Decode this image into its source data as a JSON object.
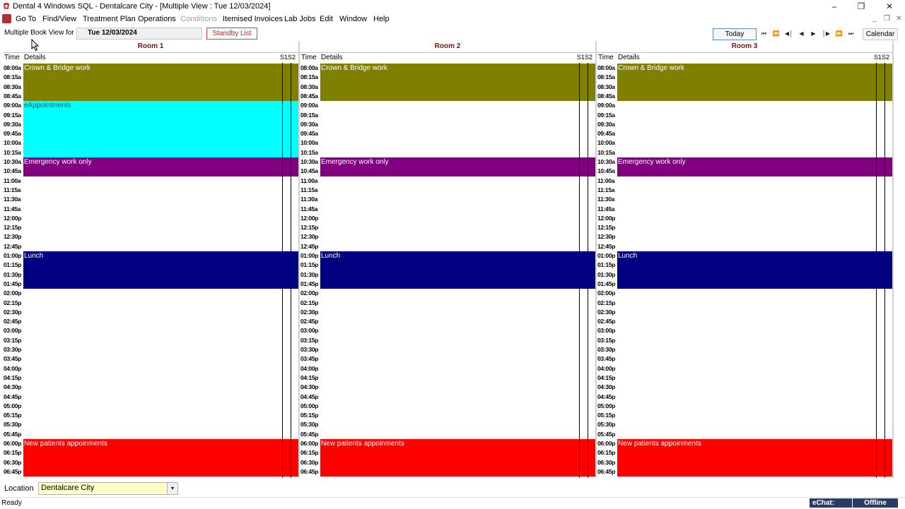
{
  "window": {
    "title": "Dental 4 Windows SQL - Dentalcare City - [Multiple View : Tue 12/03/2024]",
    "controls": {
      "minimize": "–",
      "restore": "❐",
      "close": "✕"
    }
  },
  "menu": {
    "items": [
      {
        "label": "Go To",
        "disabled": false
      },
      {
        "label": "Find/View",
        "disabled": false
      },
      {
        "label": "Treatment Plan",
        "disabled": false
      },
      {
        "label": "Operations",
        "disabled": false
      },
      {
        "label": "Conditions",
        "disabled": true
      },
      {
        "label": "Itemised Invoices",
        "disabled": false
      },
      {
        "label": "Lab Jobs",
        "disabled": false
      },
      {
        "label": "Edit",
        "disabled": false
      },
      {
        "label": "Window",
        "disabled": false
      },
      {
        "label": "Help",
        "disabled": false
      }
    ],
    "mdi_controls": {
      "minimize": "_",
      "restore": "❐",
      "close": "✕"
    }
  },
  "toolbar": {
    "view_label": "Multiple Book View for",
    "date": "Tue 12/03/2024",
    "standby_list": "Standby List",
    "today": "Today",
    "calendar": "Calendar",
    "nav_icons": [
      "skip-back-icon",
      "fast-back-icon",
      "step-back-icon",
      "back-icon",
      "forward-icon",
      "step-forward-icon",
      "fast-forward-icon",
      "skip-forward-icon"
    ],
    "nav_glyphs": [
      "⏮",
      "⏪",
      "◀│",
      "◀",
      "▶",
      "│▶",
      "⏩",
      "⏭"
    ]
  },
  "columns": {
    "time": "Time",
    "details": "Details",
    "s1s2": "S1S2"
  },
  "times": [
    "08:00a",
    "08:15a",
    "08:30a",
    "08:45a",
    "09:00a",
    "09:15a",
    "09:30a",
    "09:45a",
    "10:00a",
    "10:15a",
    "10:30a",
    "10:45a",
    "11:00a",
    "11:15a",
    "11:30a",
    "11:45a",
    "12:00p",
    "12:15p",
    "12:30p",
    "12:45p",
    "01:00p",
    "01:15p",
    "01:30p",
    "01:45p",
    "02:00p",
    "02:15p",
    "02:30p",
    "02:45p",
    "03:00p",
    "03:15p",
    "03:30p",
    "03:45p",
    "04:00p",
    "04:15p",
    "04:30p",
    "04:45p",
    "05:00p",
    "05:15p",
    "05:30p",
    "05:45p",
    "06:00p",
    "06:15p",
    "06:30p",
    "06:45p"
  ],
  "rooms": [
    {
      "name": "Room 1",
      "blocks": [
        {
          "label": "Crown & Bridge work",
          "start": 0,
          "slots": 4,
          "color": "#808000",
          "text_color": "#ffffff"
        },
        {
          "label": "eAppointments",
          "start": 4,
          "slots": 6,
          "color": "#00ffff",
          "text_color": "#006060"
        },
        {
          "label": "Emergency work only",
          "start": 10,
          "slots": 2,
          "color": "#800080",
          "text_color": "#ffffff"
        },
        {
          "label": "Lunch",
          "start": 20,
          "slots": 4,
          "color": "#000080",
          "text_color": "#ffffff"
        },
        {
          "label": "New patients appoinments",
          "start": 40,
          "slots": 4,
          "color": "#ff0000",
          "text_color": "#ffffff"
        }
      ]
    },
    {
      "name": "Room 2",
      "blocks": [
        {
          "label": "Crown & Bridge work",
          "start": 0,
          "slots": 4,
          "color": "#808000",
          "text_color": "#ffffff"
        },
        {
          "label": "Emergency work only",
          "start": 10,
          "slots": 2,
          "color": "#800080",
          "text_color": "#ffffff"
        },
        {
          "label": "Lunch",
          "start": 20,
          "slots": 4,
          "color": "#000080",
          "text_color": "#ffffff"
        },
        {
          "label": "New patients appoinments",
          "start": 40,
          "slots": 4,
          "color": "#ff0000",
          "text_color": "#ffffff"
        }
      ]
    },
    {
      "name": "Room 3",
      "blocks": [
        {
          "label": "Crown & Bridge work",
          "start": 0,
          "slots": 4,
          "color": "#808000",
          "text_color": "#ffffff"
        },
        {
          "label": "Emergency work only",
          "start": 10,
          "slots": 2,
          "color": "#800080",
          "text_color": "#ffffff"
        },
        {
          "label": "Lunch",
          "start": 20,
          "slots": 4,
          "color": "#000080",
          "text_color": "#ffffff"
        },
        {
          "label": "New patients appoinments",
          "start": 40,
          "slots": 4,
          "color": "#ff0000",
          "text_color": "#ffffff"
        }
      ]
    }
  ],
  "location": {
    "label": "Location",
    "value": "Dentalcare City",
    "arrow": "▾"
  },
  "status": {
    "text": "Ready",
    "echat": "eChat:",
    "offline": "Offline"
  }
}
